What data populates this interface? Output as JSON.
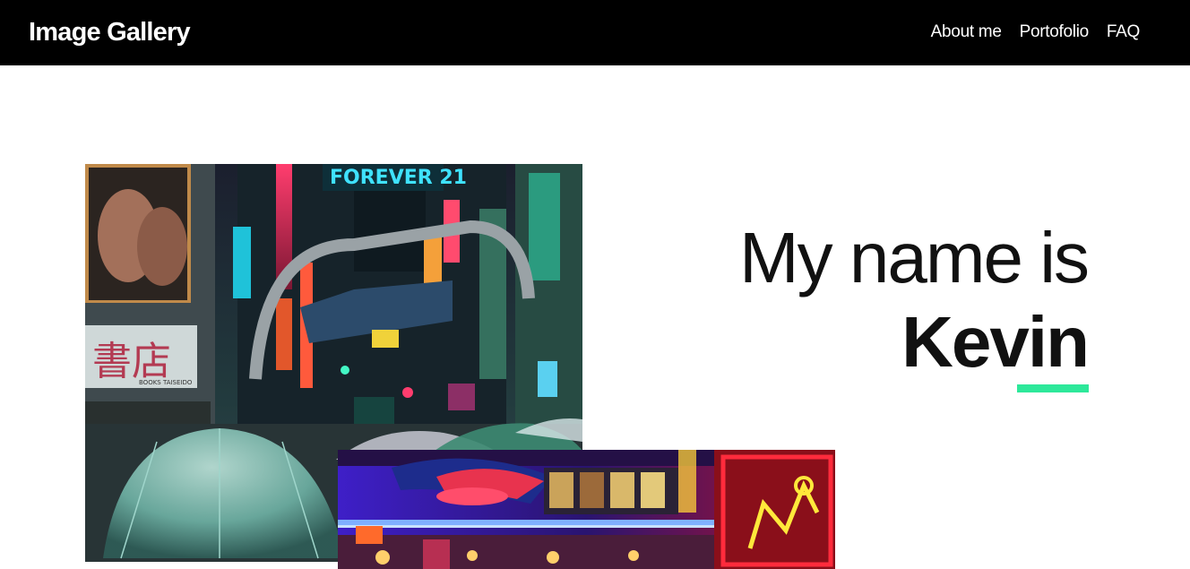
{
  "header": {
    "brand": "Image Gallery",
    "nav": [
      {
        "label": "About me"
      },
      {
        "label": "Portofolio"
      },
      {
        "label": "FAQ"
      }
    ]
  },
  "hero": {
    "line1": "My name is",
    "name": "Kevin"
  },
  "photos": [
    {
      "subject": "neon city street at night with umbrellas",
      "signs": [
        "FOREVER 21",
        "書店",
        "BOOKS TAISEIDO"
      ]
    },
    {
      "subject": "neon-lit arcade ceiling interior"
    }
  ],
  "colors": {
    "navbar": "#000000",
    "accent": "#2de89a",
    "text": "#111111"
  },
  "icons": {
    "photo_1": "city-street-photo",
    "photo_2": "neon-arcade-photo"
  }
}
